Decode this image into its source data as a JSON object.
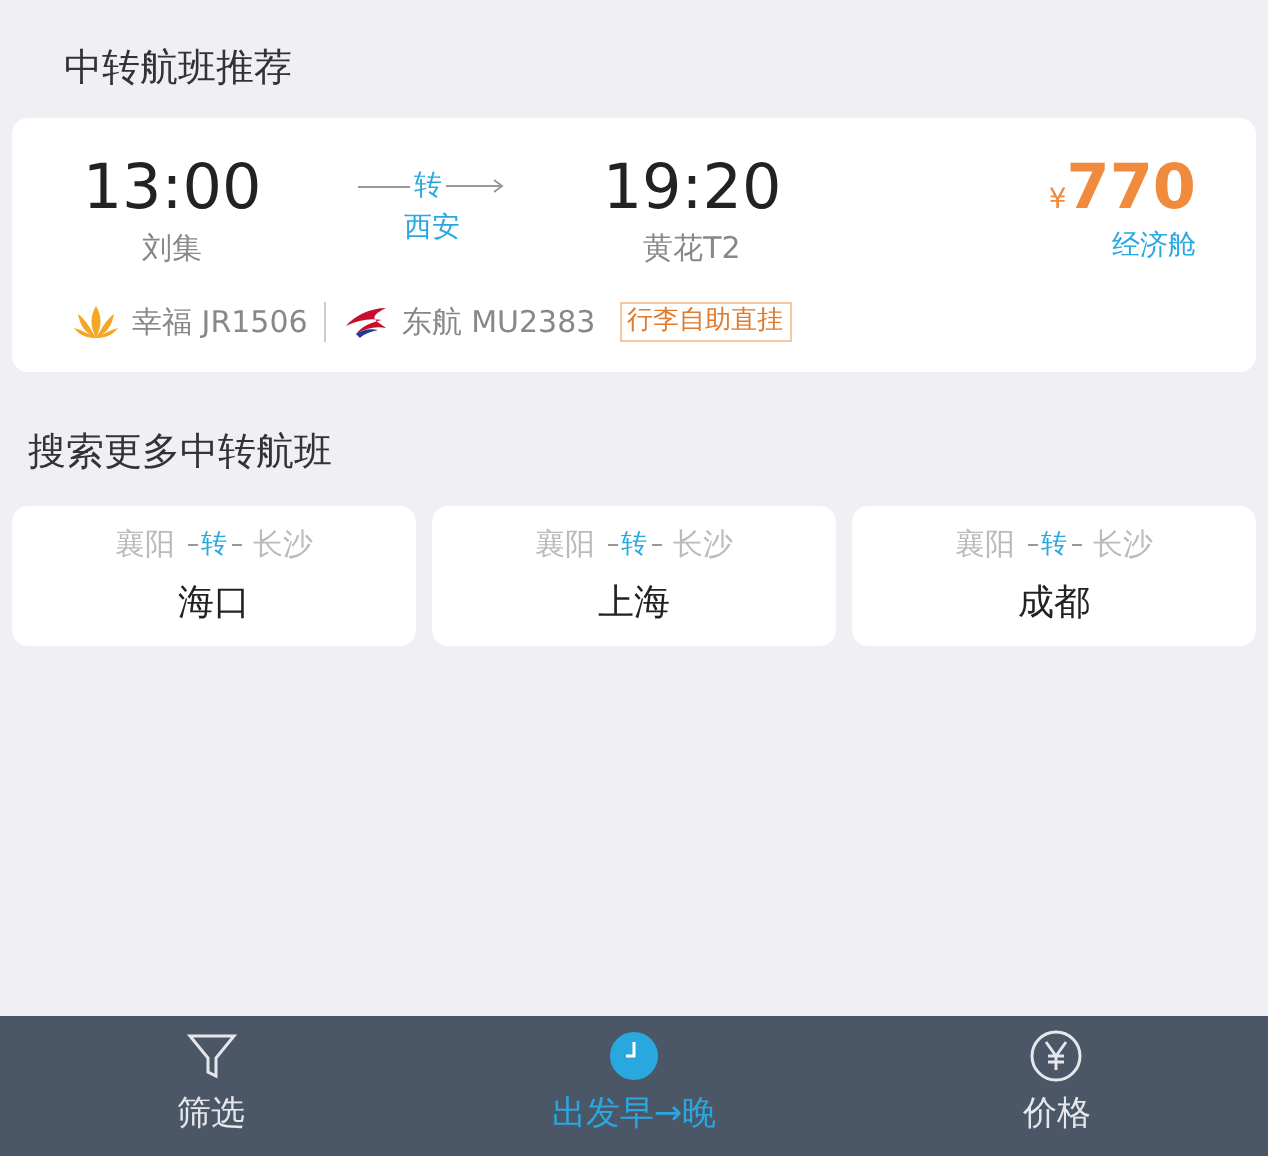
{
  "recommend": {
    "title": "中转航班推荐",
    "flight": {
      "depart_time": "13:00",
      "depart_airport": "刘集",
      "transfer_label": "转",
      "transfer_city": "西安",
      "arrive_time": "19:20",
      "arrive_airport": "黄花T2",
      "currency": "¥",
      "price": "770",
      "cabin": "经济舱",
      "legs": [
        {
          "kind": "sun",
          "text": "幸福 JR1506"
        },
        {
          "kind": "swallow",
          "text": "东航 MU2383"
        }
      ],
      "tag": "行李自助直挂"
    }
  },
  "more": {
    "title": "搜索更多中转航班",
    "routes": [
      {
        "from": "襄阳",
        "via": "转",
        "to": "长沙",
        "dest": "海口"
      },
      {
        "from": "襄阳",
        "via": "转",
        "to": "长沙",
        "dest": "上海"
      },
      {
        "from": "襄阳",
        "via": "转",
        "to": "长沙",
        "dest": "成都"
      }
    ]
  },
  "tabbar": [
    {
      "kind": "filter",
      "label": "筛选",
      "selected": false
    },
    {
      "kind": "clock",
      "label": "出发早→晚",
      "selected": true
    },
    {
      "kind": "yen",
      "label": "价格",
      "selected": false
    }
  ]
}
